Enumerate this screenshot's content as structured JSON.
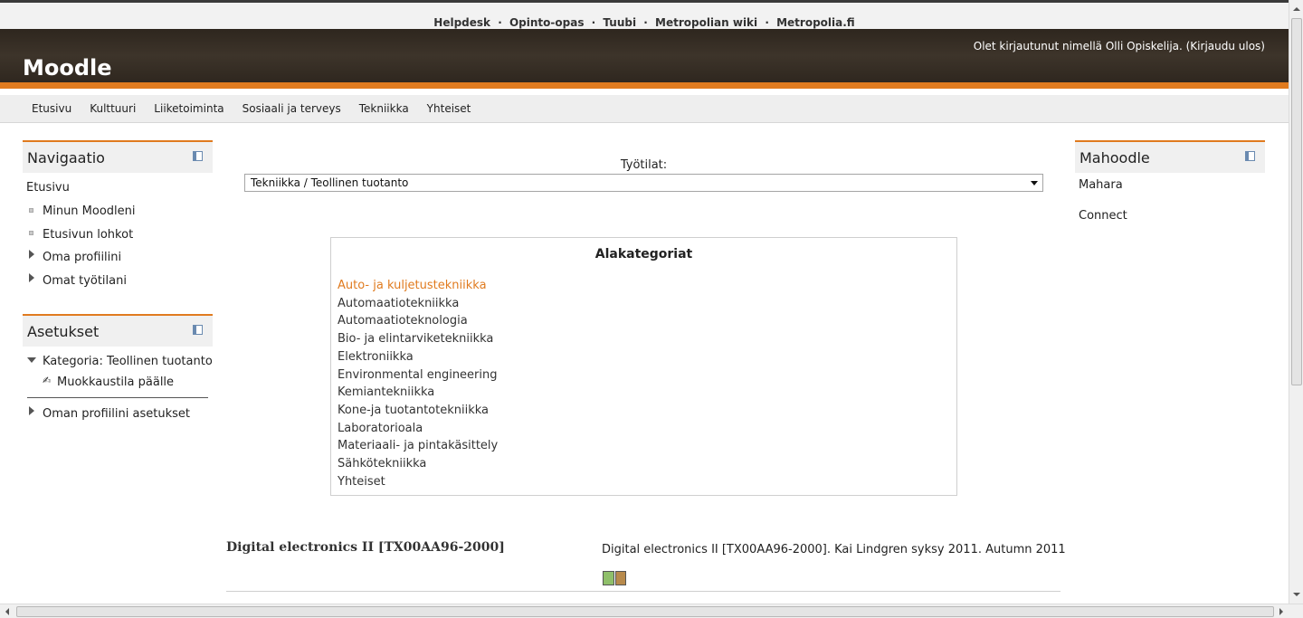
{
  "toplinks": {
    "items": [
      "Helpdesk",
      "Opinto-opas",
      "Tuubi",
      "Metropolian wiki",
      "Metropolia.fi"
    ],
    "separator": "·"
  },
  "header": {
    "logo": "Moodle",
    "login_text": "Olet kirjautunut nimellä Olli Opiskelija. (Kirjaudu ulos)"
  },
  "menu": [
    "Etusivu",
    "Kulttuuri",
    "Liiketoiminta",
    "Sosiaali ja terveys",
    "Tekniikka",
    "Yhteiset"
  ],
  "navigation": {
    "title": "Navigaatio",
    "home": "Etusivu",
    "items": [
      "Minun Moodleni",
      "Etusivun lohkot",
      "Oma profiilini",
      "Omat työtilani"
    ]
  },
  "settings": {
    "title": "Asetukset",
    "category": "Kategoria: Teollinen tuotanto",
    "edit_mode": "Muokkaustila päälle",
    "profile_settings": "Oman profiilini asetukset"
  },
  "mahoodle": {
    "title": "Mahoodle",
    "items": [
      "Mahara",
      "Connect"
    ]
  },
  "workspace": {
    "label": "Työtilat:",
    "selected": "Tekniikka / Teollinen tuotanto"
  },
  "subcategories": {
    "title": "Alakategoriat",
    "items": [
      "Auto- ja kuljetustekniikka",
      "Automaatiotekniikka",
      "Automaatioteknologia",
      "Bio- ja elintarviketekniikka",
      "Elektroniikka",
      "Environmental engineering",
      "Kemiantekniikka",
      "Kone-ja tuotantotekniikka",
      "Laboratorioala",
      "Materiaali- ja pintakäsittely",
      "Sähkötekniikka",
      "Yhteiset"
    ]
  },
  "course": {
    "title": "Digital electronics II [TX00AA96-2000]",
    "description": "Digital electronics II [TX00AA96-2000]. Kai Lindgren syksy 2011. Autumn 2011"
  },
  "colors": {
    "accent": "#e07b1f",
    "header_bg": "#362d24"
  }
}
